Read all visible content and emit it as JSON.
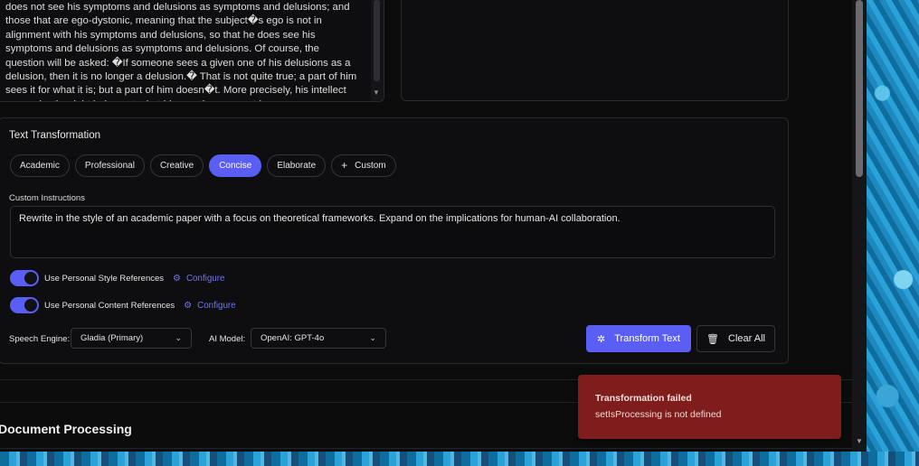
{
  "input": {
    "text": "does not see his symptoms and delusions as symptoms and delusions; and those that are ego-dystonic, meaning that the subject�s ego is not in alignment with his symptoms and delusions, so that he does see his symptoms and delusions as symptoms and delusions. Of course, the question will be asked: �If someone sees a given one of his delusions as a delusion, then it is no longer a delusion.� That is not quite true; a part of him sees it for what it is; but a part of him doesn�t. More precisely, his intellect can make the right judgments; but his emotions are not in"
  },
  "transformation": {
    "title": "Text Transformation",
    "styles": [
      "Academic",
      "Professional",
      "Creative",
      "Concise",
      "Elaborate"
    ],
    "active_style": "Concise",
    "custom_label": "Custom",
    "custom_instructions_label": "Custom Instructions",
    "custom_instructions_value": "Rewrite in the style of an academic paper with a focus on theoretical frameworks. Expand on the implications for human-AI collaboration.",
    "toggles": [
      {
        "label": "Use Personal Style References",
        "link": "Configure",
        "on": true
      },
      {
        "label": "Use Personal Content References",
        "link": "Configure",
        "on": true
      }
    ],
    "speech_engine_label": "Speech Engine:",
    "speech_engine_value": "Gladia (Primary)",
    "ai_model_label": "AI Model:",
    "ai_model_value": "OpenAI: GPT-4o",
    "transform_button": "Transform Text",
    "clear_button": "Clear All"
  },
  "section": {
    "document_processing_title": "Document Processing"
  },
  "toast": {
    "title": "Transformation failed",
    "message": "setIsProcessing is not defined"
  },
  "icons": {
    "gear": "gear-icon",
    "plus": "plus-icon",
    "sparkle": "sparkle-icon",
    "trash": "trash-icon",
    "chevron": "chevron-down-icon"
  },
  "colors": {
    "accent": "#5b5ef5",
    "error_toast": "#7f1d1d",
    "background": "#0c0c0d"
  }
}
